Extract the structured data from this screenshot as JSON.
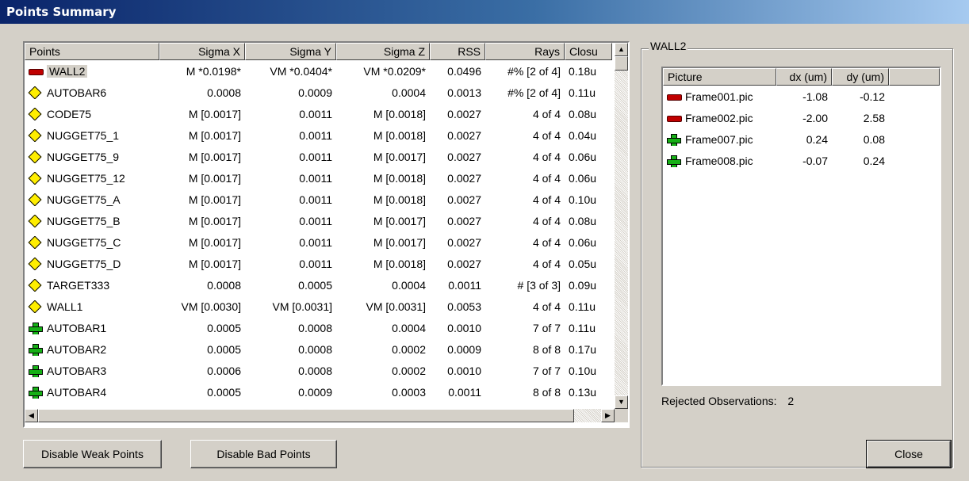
{
  "window": {
    "title": "Points Summary"
  },
  "points_table": {
    "columns": [
      "Points",
      "Sigma X",
      "Sigma Y",
      "Sigma Z",
      "RSS",
      "Rays",
      "Closu"
    ],
    "rows": [
      {
        "icon": "red-dash-icon",
        "name": "WALL2",
        "sx": "M *0.0198*",
        "sy": "VM *0.0404*",
        "sz": "VM *0.0209*",
        "rss": "0.0496",
        "rays": "#% [2 of 4]",
        "closure": "0.18u",
        "selected": true
      },
      {
        "icon": "yellow-diamond-icon",
        "name": "AUTOBAR6",
        "sx": "0.0008",
        "sy": "0.0009",
        "sz": "0.0004",
        "rss": "0.0013",
        "rays": "#% [2 of 4]",
        "closure": "0.11u"
      },
      {
        "icon": "yellow-diamond-icon",
        "name": "CODE75",
        "sx": "M [0.0017]",
        "sy": "0.0011",
        "sz": "M [0.0018]",
        "rss": "0.0027",
        "rays": "4 of 4",
        "closure": "0.08u"
      },
      {
        "icon": "yellow-diamond-icon",
        "name": "NUGGET75_1",
        "sx": "M [0.0017]",
        "sy": "0.0011",
        "sz": "M [0.0018]",
        "rss": "0.0027",
        "rays": "4 of 4",
        "closure": "0.04u"
      },
      {
        "icon": "yellow-diamond-icon",
        "name": "NUGGET75_9",
        "sx": "M [0.0017]",
        "sy": "0.0011",
        "sz": "M [0.0017]",
        "rss": "0.0027",
        "rays": "4 of 4",
        "closure": "0.06u"
      },
      {
        "icon": "yellow-diamond-icon",
        "name": "NUGGET75_12",
        "sx": "M [0.0017]",
        "sy": "0.0011",
        "sz": "M [0.0018]",
        "rss": "0.0027",
        "rays": "4 of 4",
        "closure": "0.06u"
      },
      {
        "icon": "yellow-diamond-icon",
        "name": "NUGGET75_A",
        "sx": "M [0.0017]",
        "sy": "0.0011",
        "sz": "M [0.0018]",
        "rss": "0.0027",
        "rays": "4 of 4",
        "closure": "0.10u"
      },
      {
        "icon": "yellow-diamond-icon",
        "name": "NUGGET75_B",
        "sx": "M [0.0017]",
        "sy": "0.0011",
        "sz": "M [0.0017]",
        "rss": "0.0027",
        "rays": "4 of 4",
        "closure": "0.08u"
      },
      {
        "icon": "yellow-diamond-icon",
        "name": "NUGGET75_C",
        "sx": "M [0.0017]",
        "sy": "0.0011",
        "sz": "M [0.0017]",
        "rss": "0.0027",
        "rays": "4 of 4",
        "closure": "0.06u"
      },
      {
        "icon": "yellow-diamond-icon",
        "name": "NUGGET75_D",
        "sx": "M [0.0017]",
        "sy": "0.0011",
        "sz": "M [0.0018]",
        "rss": "0.0027",
        "rays": "4 of 4",
        "closure": "0.05u"
      },
      {
        "icon": "yellow-diamond-icon",
        "name": "TARGET333",
        "sx": "0.0008",
        "sy": "0.0005",
        "sz": "0.0004",
        "rss": "0.0011",
        "rays": "# [3 of 3]",
        "closure": "0.09u"
      },
      {
        "icon": "yellow-diamond-icon",
        "name": "WALL1",
        "sx": "VM [0.0030]",
        "sy": "VM [0.0031]",
        "sz": "VM [0.0031]",
        "rss": "0.0053",
        "rays": "4 of 4",
        "closure": "0.11u"
      },
      {
        "icon": "green-cross-icon",
        "name": "AUTOBAR1",
        "sx": "0.0005",
        "sy": "0.0008",
        "sz": "0.0004",
        "rss": "0.0010",
        "rays": "7 of 7",
        "closure": "0.11u"
      },
      {
        "icon": "green-cross-icon",
        "name": "AUTOBAR2",
        "sx": "0.0005",
        "sy": "0.0008",
        "sz": "0.0002",
        "rss": "0.0009",
        "rays": "8 of 8",
        "closure": "0.17u"
      },
      {
        "icon": "green-cross-icon",
        "name": "AUTOBAR3",
        "sx": "0.0006",
        "sy": "0.0008",
        "sz": "0.0002",
        "rss": "0.0010",
        "rays": "7 of 7",
        "closure": "0.10u"
      },
      {
        "icon": "green-cross-icon",
        "name": "AUTOBAR4",
        "sx": "0.0005",
        "sy": "0.0009",
        "sz": "0.0003",
        "rss": "0.0011",
        "rays": "8 of 8",
        "closure": "0.13u"
      }
    ]
  },
  "detail": {
    "group_label": "WALL2",
    "columns": [
      "Picture",
      "dx (um)",
      "dy (um)"
    ],
    "rows": [
      {
        "icon": "red-dash-icon",
        "picture": "Frame001.pic",
        "dx": "-1.08",
        "dy": "-0.12"
      },
      {
        "icon": "red-dash-icon",
        "picture": "Frame002.pic",
        "dx": "-2.00",
        "dy": "2.58"
      },
      {
        "icon": "green-cross-icon",
        "picture": "Frame007.pic",
        "dx": "0.24",
        "dy": "0.08"
      },
      {
        "icon": "green-cross-icon",
        "picture": "Frame008.pic",
        "dx": "-0.07",
        "dy": "0.24"
      }
    ],
    "rejected_label": "Rejected Observations:",
    "rejected_count": "2"
  },
  "buttons": {
    "disable_weak": "Disable Weak Points",
    "disable_bad": "Disable Bad Points",
    "close": "Close"
  },
  "colors": {
    "title_bar_start": "#0a246a",
    "title_bar_end": "#a6caf0",
    "dialog_face": "#d4d0c8"
  }
}
